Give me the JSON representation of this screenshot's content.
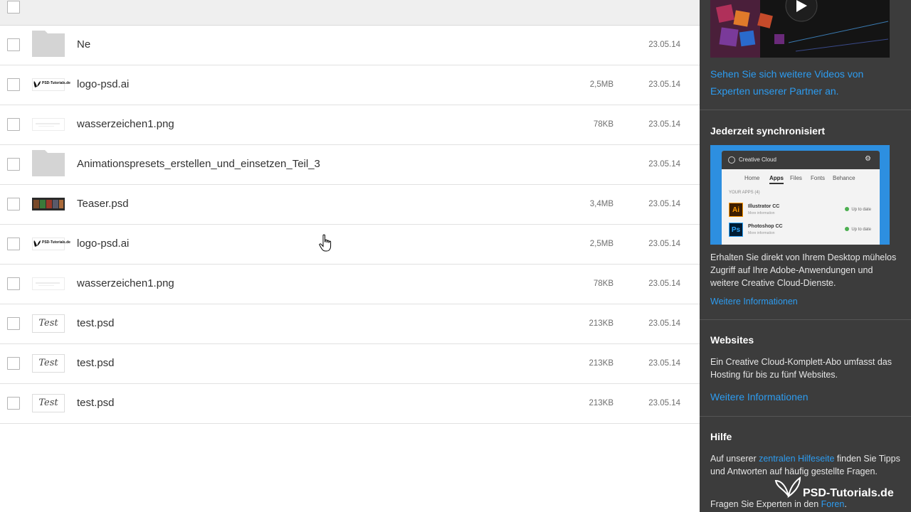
{
  "files": [
    {
      "name": "Ne",
      "size": "",
      "date": "23.05.14",
      "thumb": "folder"
    },
    {
      "name": "logo-psd.ai",
      "size": "2,5MB",
      "date": "23.05.14",
      "thumb": "logo"
    },
    {
      "name": "wasserzeichen1.png",
      "size": "78KB",
      "date": "23.05.14",
      "thumb": "watermark"
    },
    {
      "name": "Animationspresets_erstellen_und_einsetzen_Teil_3",
      "size": "",
      "date": "23.05.14",
      "thumb": "folder"
    },
    {
      "name": "Teaser.psd",
      "size": "3,4MB",
      "date": "23.05.14",
      "thumb": "teaser"
    },
    {
      "name": "logo-psd.ai",
      "size": "2,5MB",
      "date": "23.05.14",
      "thumb": "logo"
    },
    {
      "name": "wasserzeichen1.png",
      "size": "78KB",
      "date": "23.05.14",
      "thumb": "watermark"
    },
    {
      "name": "test.psd",
      "size": "213KB",
      "date": "23.05.14",
      "thumb": "test"
    },
    {
      "name": "test.psd",
      "size": "213KB",
      "date": "23.05.14",
      "thumb": "test"
    },
    {
      "name": "test.psd",
      "size": "213KB",
      "date": "23.05.14",
      "thumb": "test"
    }
  ],
  "thumb_text": {
    "logo": "PSD-Tutorials.de",
    "test": "Test"
  },
  "sidebar": {
    "video_link": "Sehen Sie sich weitere Videos von Experten unserer Partner an.",
    "sync": {
      "title": "Jederzeit synchronisiert",
      "text": "Erhalten Sie direkt von Ihrem Desktop mühelos Zugriff auf Ihre Adobe-Anwendungen und weitere Creative Cloud-Dienste.",
      "link": "Weitere Informationen"
    },
    "cc_panel": {
      "app_title": "Creative Cloud",
      "tabs": [
        "Home",
        "Apps",
        "Files",
        "Fonts",
        "Behance"
      ],
      "active_tab": "Apps",
      "apps_label": "YOUR APPS (4)",
      "apps": [
        {
          "icon": "Ai",
          "name": "Illustrator CC",
          "sub": "More information",
          "status": "Up to date",
          "color": "#ff9a00",
          "bg": "#3d1e00"
        },
        {
          "icon": "Ps",
          "name": "Photoshop CC",
          "sub": "More information",
          "status": "Up to date",
          "color": "#31a8ff",
          "bg": "#001c33"
        }
      ]
    },
    "websites": {
      "title": "Websites",
      "text": "Ein Creative Cloud-Komplett-Abo umfasst das Hosting für bis zu fünf Websites.",
      "link": "Weitere Informationen"
    },
    "help": {
      "title": "Hilfe",
      "text_before": "Auf unserer ",
      "link": "zentralen Hilfeseite",
      "text_after": " finden Sie Tipps und Antworten auf häufig gestellte Fragen.",
      "forum_before": "Fragen Sie Experten in den ",
      "forum_link": "Foren",
      "forum_after": "."
    },
    "watermark": "PSD-Tutorials.de"
  },
  "colors": {
    "sidebar_bg": "#3c3c3c",
    "link": "#2d9cf0",
    "cc_blue": "#2d8fe0"
  }
}
